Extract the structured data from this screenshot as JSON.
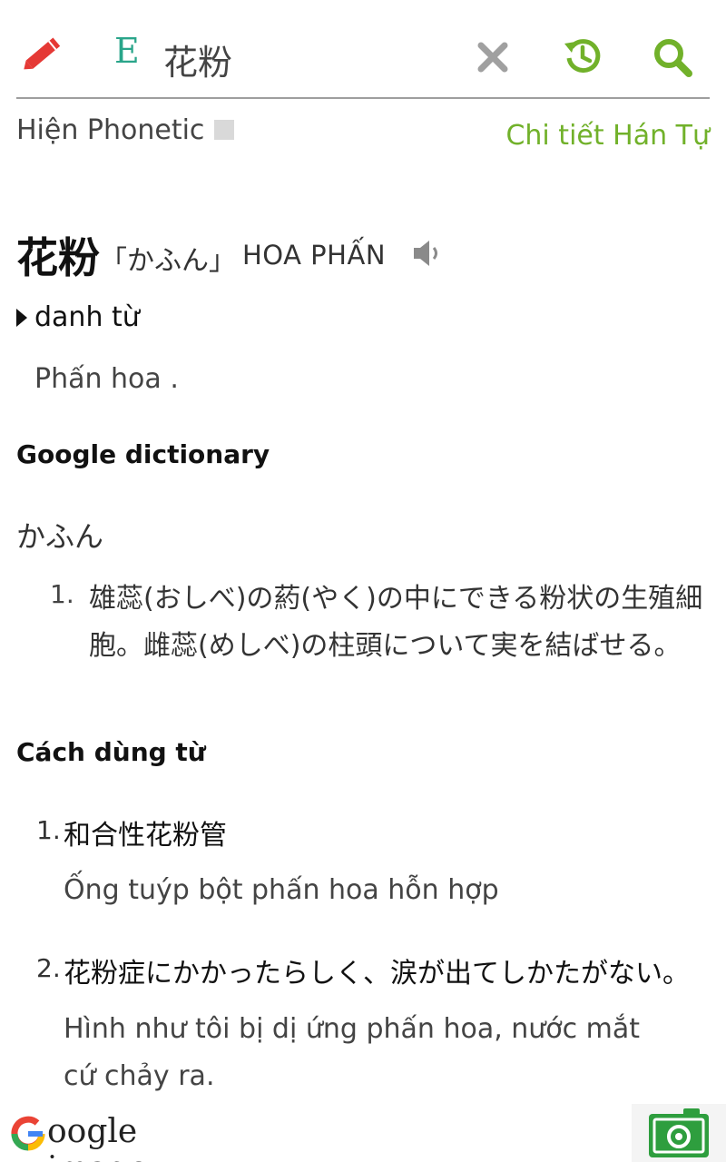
{
  "search": {
    "lang_letter": "E",
    "query": "花粉",
    "icons": [
      "pencil-icon",
      "close-icon",
      "history-icon",
      "search-icon"
    ]
  },
  "phonetic": {
    "label": "Hiện Phonetic",
    "kanji_detail_link": "Chi tiết Hán Tự"
  },
  "entry": {
    "headword": "花粉",
    "reading": "「かふん」",
    "hanviet": "HOA PHẤN",
    "part_of_speech": "danh từ",
    "meaning": "Phấn hoa ."
  },
  "google_dictionary": {
    "title": "Google dictionary",
    "reading": "かふん",
    "definitions": [
      {
        "num": "1.",
        "text": "雄蕊(おしべ)の葯(やく)の中にできる粉状の生殖細胞。雌蕊(めしべ)の柱頭について実を結ばせる。"
      }
    ]
  },
  "usage": {
    "title": "Cách dùng từ",
    "examples": [
      {
        "num": "1.",
        "jp": "和合性花粉管",
        "vi": "Ống tuýp bột phấn hoa hỗn hợp"
      },
      {
        "num": "2.",
        "jp": "花粉症にかかったらしく、涙が出てしかたがない。",
        "vi": "Hình như tôi bị dị ứng phấn hoa, nước mắt cứ chảy ra."
      }
    ]
  },
  "bottom": {
    "google_image_text": "oogle image"
  },
  "colors": {
    "accent_green": "#71b12a",
    "lang_green": "#2aa58a",
    "pencil_red": "#e53935"
  }
}
